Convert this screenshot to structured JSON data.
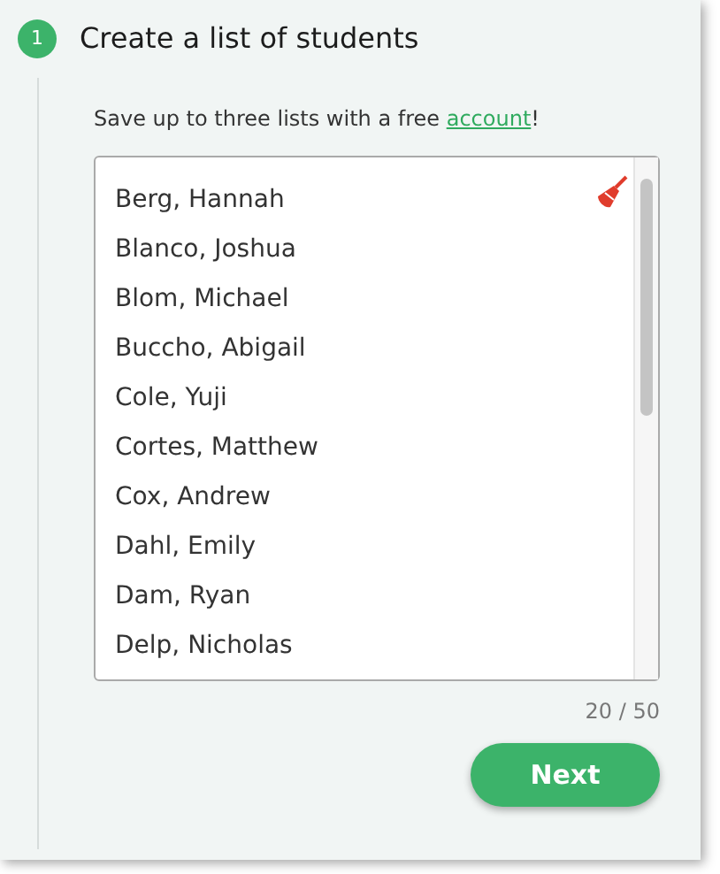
{
  "step": {
    "number": "1",
    "title": "Create a list of students"
  },
  "note": {
    "before": "Save up to three lists with a free ",
    "link": "account",
    "after": "!"
  },
  "students": [
    "Berg, Hannah",
    "Blanco, Joshua",
    "Blom, Michael",
    "Buccho, Abigail",
    "Cole, Yuji",
    "Cortes, Matthew",
    "Cox, Andrew",
    "Dahl, Emily",
    "Dam, Ryan",
    "Delp, Nicholas"
  ],
  "counter": "20 / 50",
  "next_button": "Next"
}
